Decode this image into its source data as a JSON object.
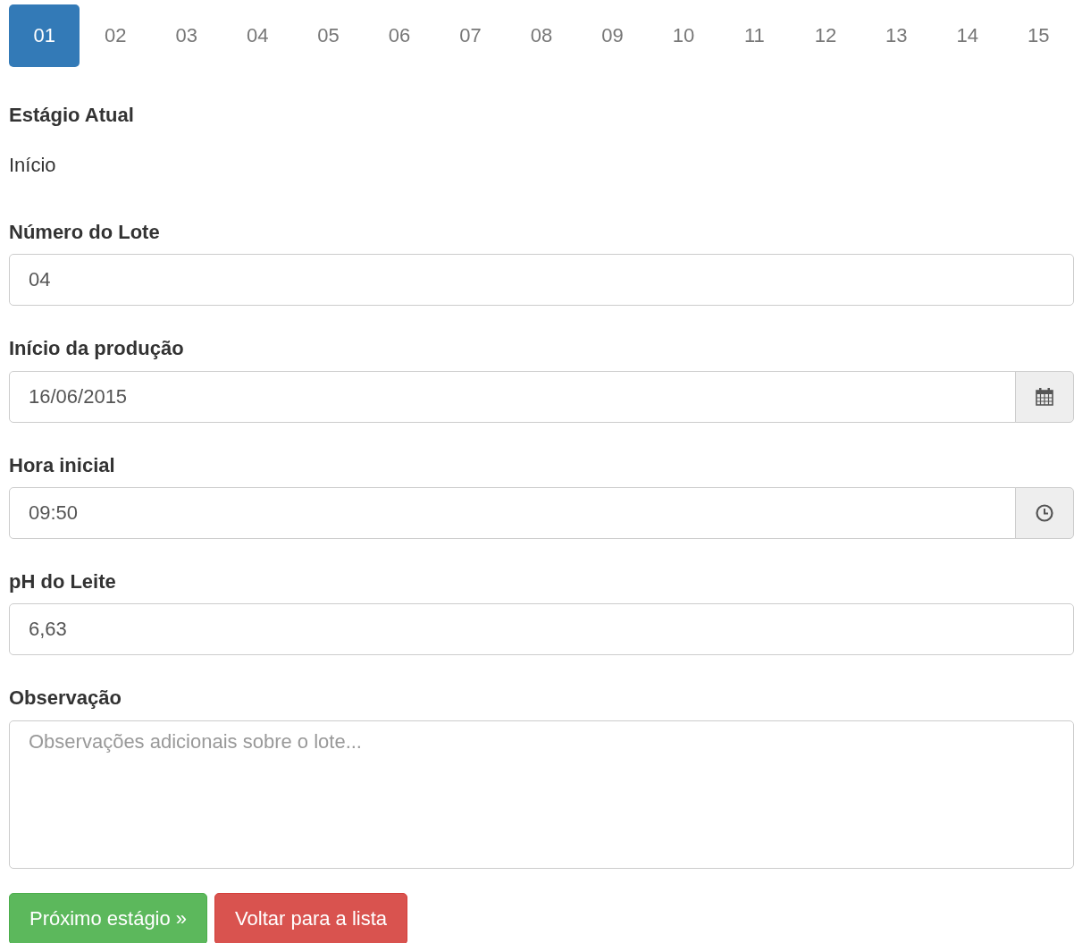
{
  "steps": [
    {
      "label": "01",
      "selected": true
    },
    {
      "label": "02",
      "selected": false
    },
    {
      "label": "03",
      "selected": false
    },
    {
      "label": "04",
      "selected": false
    },
    {
      "label": "05",
      "selected": false
    },
    {
      "label": "06",
      "selected": false
    },
    {
      "label": "07",
      "selected": false
    },
    {
      "label": "08",
      "selected": false
    },
    {
      "label": "09",
      "selected": false
    },
    {
      "label": "10",
      "selected": false
    },
    {
      "label": "11",
      "selected": false
    },
    {
      "label": "12",
      "selected": false
    },
    {
      "label": "13",
      "selected": false
    },
    {
      "label": "14",
      "selected": false
    },
    {
      "label": "15",
      "selected": false
    }
  ],
  "current_stage": {
    "label": "Estágio Atual",
    "value": "Início"
  },
  "fields": [
    {
      "kind": "text",
      "label": "Número do Lote",
      "value": "04"
    },
    {
      "kind": "date",
      "label": "Início da produção",
      "value": "16/06/2015"
    },
    {
      "kind": "time",
      "label": "Hora inicial",
      "value": "09:50"
    },
    {
      "kind": "text",
      "label": "pH do Leite",
      "value": "6,63"
    },
    {
      "kind": "textarea",
      "label": "Observação",
      "placeholder": "Observações adicionais sobre o lote..."
    }
  ],
  "buttons": [
    {
      "kind": "success",
      "label": "Próximo estágio »"
    },
    {
      "kind": "danger",
      "label": "Voltar para a lista"
    }
  ]
}
